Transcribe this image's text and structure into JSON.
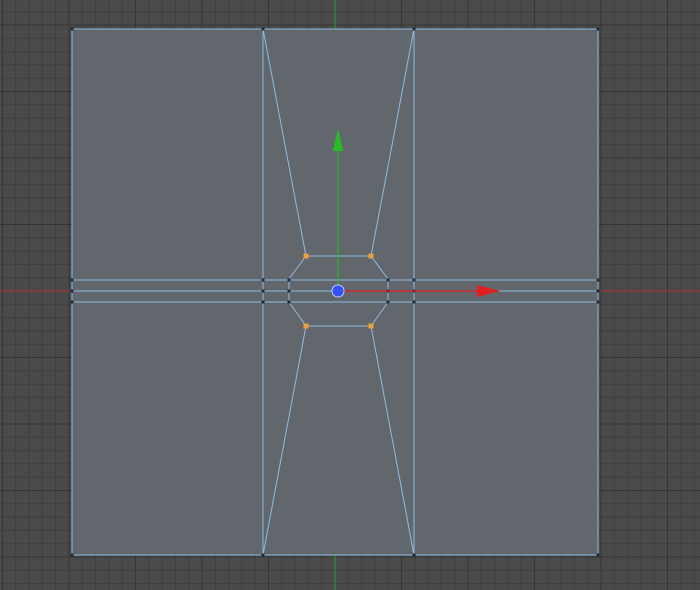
{
  "viewport": {
    "view": "orthographic-top",
    "grid_visible": true,
    "selection_mode": "point"
  },
  "colors": {
    "background": "#4a4a4a",
    "grid_minor": "#3f3f3f",
    "grid_major": "#353535",
    "axis_x": "#b03030",
    "axis_y": "#2f9a2f",
    "face_fill": "#62676d",
    "edge": "#8fbbe0",
    "vertex": "#1e2a36",
    "selected_point": "#f0a030",
    "gizmo_x": "#e02020",
    "gizmo_y": "#20c020",
    "gizmo_center": "#3050ff"
  },
  "mesh": {
    "object_type": "polygon-plane",
    "selected_point_count": 4
  },
  "gizmo": {
    "type": "move",
    "axes": [
      "x",
      "y"
    ]
  }
}
